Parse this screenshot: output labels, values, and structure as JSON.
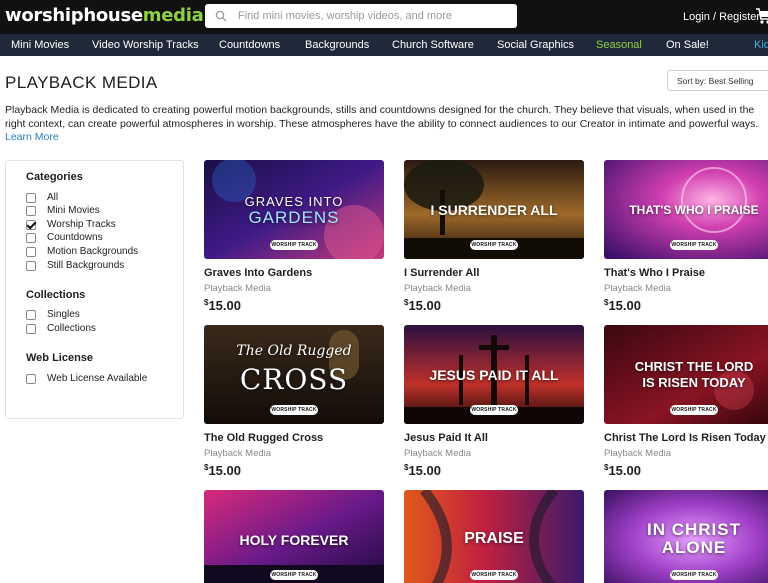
{
  "header": {
    "logo_word": "worshiphouse",
    "logo_accent": "media",
    "search_placeholder": "Find mini movies, worship videos, and more",
    "login_label": "Login / Register"
  },
  "nav": [
    "Mini Movies",
    "Video Worship Tracks",
    "Countdowns",
    "Backgrounds",
    "Church Software",
    "Social Graphics",
    "Seasonal",
    "On Sale!",
    "Kid"
  ],
  "page": {
    "title": "PLAYBACK MEDIA",
    "sort_label": "Sort by: Best Selling",
    "description": "Playback Media is dedicated to creating powerful motion backgrounds, stills and countdowns designed for the church. They believe that visuals, when used in the right context, can create powerful atmospheres in worship. These atmospheres have the ability to connect audiences to our Creator in intimate and powerful ways.",
    "learn_more": "Learn More"
  },
  "sidebar": {
    "categories_title": "Categories",
    "categories": [
      {
        "label": "All",
        "checked": false
      },
      {
        "label": "Mini Movies",
        "checked": false
      },
      {
        "label": "Worship Tracks",
        "checked": true
      },
      {
        "label": "Countdowns",
        "checked": false
      },
      {
        "label": "Motion Backgrounds",
        "checked": false
      },
      {
        "label": "Still Backgrounds",
        "checked": false
      }
    ],
    "collections_title": "Collections",
    "collections": [
      {
        "label": "Singles",
        "checked": false
      },
      {
        "label": "Collections",
        "checked": false
      }
    ],
    "license_title": "Web License",
    "license": [
      {
        "label": "Web License Available",
        "checked": false
      }
    ]
  },
  "products": [
    {
      "name": "Graves Into Gardens",
      "maker": "Playback Media",
      "currency": "$",
      "price": "15.00",
      "thumb_line1": "GRAVES INTO",
      "thumb_line2": "GARDENS",
      "badge": "WORSHIP TRACK"
    },
    {
      "name": "I Surrender All",
      "maker": "Playback Media",
      "currency": "$",
      "price": "15.00",
      "thumb_line1": "I SURRENDER ALL",
      "thumb_line2": "",
      "badge": "WORSHIP TRACK"
    },
    {
      "name": "That's Who I Praise",
      "maker": "Playback Media",
      "currency": "$",
      "price": "15.00",
      "thumb_line1": "THAT'S WHO I PRAISE",
      "thumb_line2": "",
      "badge": "WORSHIP TRACK"
    },
    {
      "name": "The Old Rugged Cross",
      "maker": "Playback Media",
      "currency": "$",
      "price": "15.00",
      "thumb_line1": "The Old Rugged",
      "thumb_line2": "CROSS",
      "badge": "WORSHIP TRACK"
    },
    {
      "name": "Jesus Paid It All",
      "maker": "Playback Media",
      "currency": "$",
      "price": "15.00",
      "thumb_line1": "JESUS PAID IT ALL",
      "thumb_line2": "",
      "badge": "WORSHIP TRACK"
    },
    {
      "name": "Christ The Lord Is Risen Today",
      "maker": "Playback Media",
      "currency": "$",
      "price": "15.00",
      "thumb_line1": "CHRIST THE LORD",
      "thumb_line2": "IS RISEN TODAY",
      "badge": "WORSHIP TRACK"
    },
    {
      "name": "",
      "maker": "",
      "currency": "",
      "price": "",
      "thumb_line1": "HOLY FOREVER",
      "thumb_line2": "",
      "badge": "WORSHIP TRACK"
    },
    {
      "name": "",
      "maker": "",
      "currency": "",
      "price": "",
      "thumb_line1": "PRAISE",
      "thumb_line2": "",
      "badge": "WORSHIP TRACK"
    },
    {
      "name": "",
      "maker": "",
      "currency": "",
      "price": "",
      "thumb_line1": "IN CHRIST",
      "thumb_line2": "ALONE",
      "badge": "WORSHIP TRACK"
    }
  ],
  "colors": {
    "brand_green": "#8fd142",
    "nav_bg": "#20293a",
    "link_blue": "#2a7fc4"
  }
}
